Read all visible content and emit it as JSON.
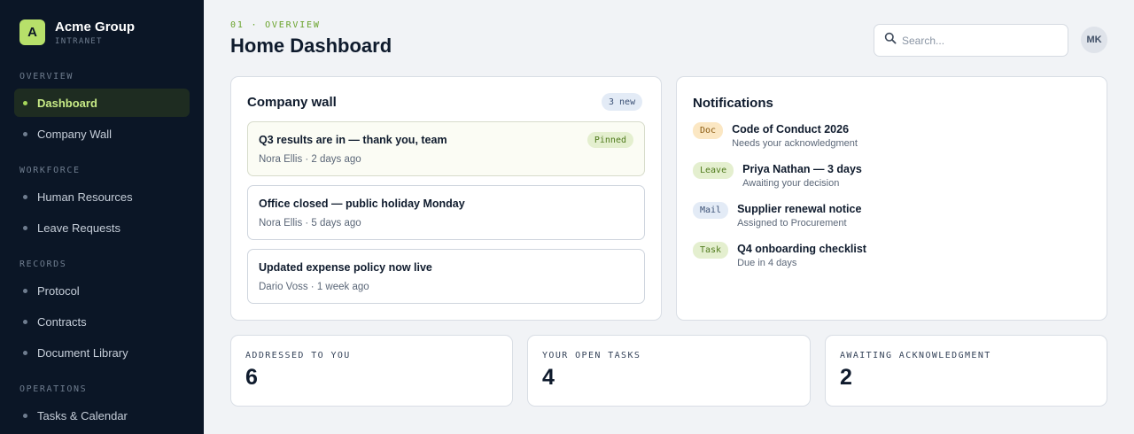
{
  "brand": {
    "logo_letter": "A",
    "name": "Acme Group",
    "subtitle": "INTRANET"
  },
  "sidebar": {
    "sections": [
      "OVERVIEW",
      "WORKFORCE",
      "RECORDS",
      "OPERATIONS"
    ],
    "items": [
      {
        "label": "Dashboard",
        "active": true
      },
      {
        "label": "Company Wall"
      },
      {
        "label": "Human Resources"
      },
      {
        "label": "Leave Requests"
      },
      {
        "label": "Protocol"
      },
      {
        "label": "Contracts"
      },
      {
        "label": "Document Library"
      },
      {
        "label": "Tasks & Calendar"
      }
    ]
  },
  "header": {
    "breadcrumb": "01 · OVERVIEW",
    "title": "Home Dashboard",
    "search_placeholder": "Search...",
    "search_icon": "magnifier-icon",
    "avatar_initials": "MK"
  },
  "wall": {
    "title": "Company wall",
    "badge": "3 new",
    "posts": [
      {
        "title": "Q3 results are in — thank you, team",
        "meta": "Nora Ellis · 2 days ago",
        "badge": "Pinned"
      },
      {
        "title": "Office closed — public holiday Monday",
        "meta": "Nora Ellis · 5 days ago"
      },
      {
        "title": "Updated expense policy now live",
        "meta": "Dario Voss · 1 week ago"
      }
    ]
  },
  "notifications": {
    "title": "Notifications",
    "items": [
      {
        "tag": "Doc",
        "title": "Code of Conduct 2026",
        "sub": "Needs your acknowledgment"
      },
      {
        "tag": "Leave",
        "title": "Priya Nathan — 3 days",
        "sub": "Awaiting your decision"
      },
      {
        "tag": "Mail",
        "title": "Supplier renewal notice",
        "sub": "Assigned to Procurement"
      },
      {
        "tag": "Task",
        "title": "Q4 onboarding checklist",
        "sub": "Due in 4 days"
      }
    ]
  },
  "stats": [
    {
      "label": "ADDRESSED TO YOU",
      "value": "6"
    },
    {
      "label": "YOUR OPEN TASKS",
      "value": "4"
    },
    {
      "label": "AWAITING ACKNOWLEDGMENT",
      "value": "2"
    }
  ],
  "colors": {
    "sidebar_bg": "#0b1626",
    "accent": "#b7e06a",
    "page_bg": "#f1f3f6"
  }
}
